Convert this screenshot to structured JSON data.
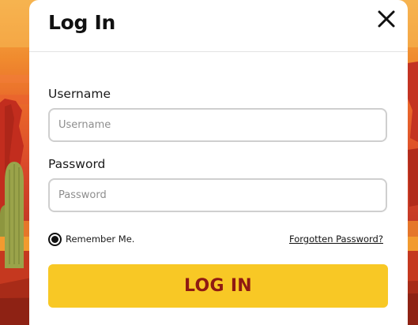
{
  "modal": {
    "title": "Log In",
    "close_icon": "close-icon"
  },
  "form": {
    "username": {
      "label": "Username",
      "placeholder": "Username",
      "value": ""
    },
    "password": {
      "label": "Password",
      "placeholder": "Password",
      "value": ""
    },
    "remember_me": {
      "label": "Remember Me.",
      "checked": true
    },
    "forgot_link": "Forgotten Password?",
    "submit_label": "LOG IN"
  },
  "colors": {
    "submit_background": "#f8c825",
    "submit_text": "#8f1a12",
    "backdrop_top": "#f6b04d",
    "backdrop_bottom": "#9e2a1c",
    "cactus": "#9aa34a"
  }
}
